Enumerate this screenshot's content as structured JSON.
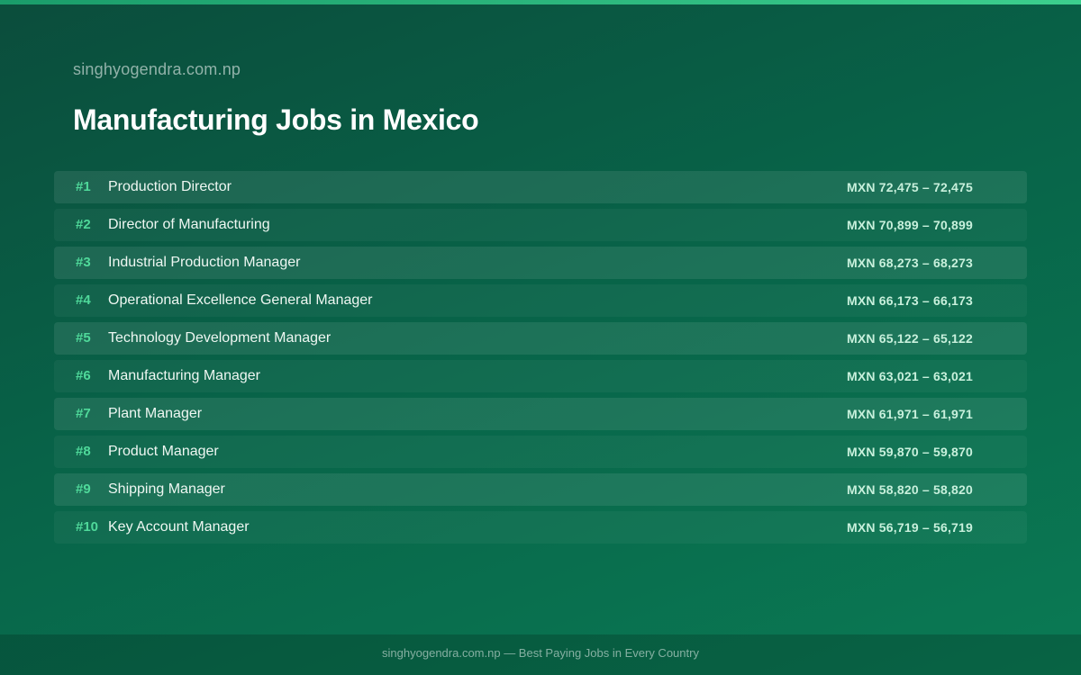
{
  "header": {
    "site_name": "singhyogendra.com.np",
    "title": "Manufacturing Jobs in Mexico"
  },
  "jobs": [
    {
      "rank": "#1",
      "title": "Production Director",
      "salary": "MXN 72,475 – 72,475"
    },
    {
      "rank": "#2",
      "title": "Director of Manufacturing",
      "salary": "MXN 70,899 – 70,899"
    },
    {
      "rank": "#3",
      "title": "Industrial Production Manager",
      "salary": "MXN 68,273 – 68,273"
    },
    {
      "rank": "#4",
      "title": "Operational Excellence General Manager",
      "salary": "MXN 66,173 – 66,173"
    },
    {
      "rank": "#5",
      "title": "Technology Development Manager",
      "salary": "MXN 65,122 – 65,122"
    },
    {
      "rank": "#6",
      "title": "Manufacturing Manager",
      "salary": "MXN 63,021 – 63,021"
    },
    {
      "rank": "#7",
      "title": "Plant Manager",
      "salary": "MXN 61,971 – 61,971"
    },
    {
      "rank": "#8",
      "title": "Product Manager",
      "salary": "MXN 59,870 – 59,870"
    },
    {
      "rank": "#9",
      "title": "Shipping Manager",
      "salary": "MXN 58,820 – 58,820"
    },
    {
      "rank": "#10",
      "title": "Key Account Manager",
      "salary": "MXN 56,719 – 56,719"
    }
  ],
  "footer": {
    "text": "singhyogendra.com.np — Best Paying Jobs in Every Country"
  },
  "colors": {
    "background": "#086348",
    "accent": "#4fd99a",
    "top_bar": "#3ccf8e"
  }
}
